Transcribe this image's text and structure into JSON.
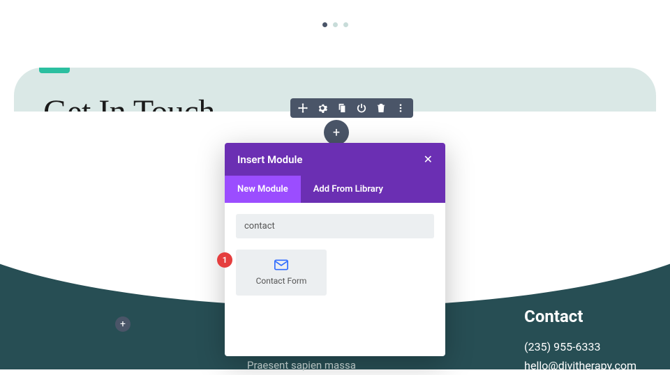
{
  "hero": {
    "title": "Get In Touch"
  },
  "contact": {
    "heading": "Contact",
    "phone": "(235) 955-6333",
    "email": "hello@divitherapy.com"
  },
  "footer_snippet": "Praesent sapien massa",
  "toolbar": {
    "icons": [
      "move-icon",
      "gear-icon",
      "duplicate-icon",
      "power-icon",
      "trash-icon",
      "more-icon"
    ]
  },
  "modal": {
    "title": "Insert Module",
    "tabs": {
      "new": "New Module",
      "library": "Add From Library"
    },
    "search_value": "contact",
    "results": [
      {
        "label": "Contact Form",
        "icon": "mail-icon"
      }
    ]
  },
  "annotation": {
    "number": "1"
  },
  "glyphs": {
    "plus": "+",
    "close": "✕",
    "add_small": "+"
  }
}
